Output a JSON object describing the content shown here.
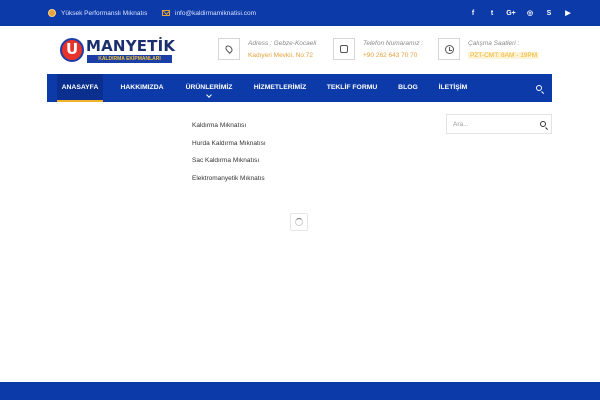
{
  "topbar": {
    "slogan": "Yüksek Performanslı Mıknatıs",
    "email": "info@kaldirmamiknatisi.com",
    "social": [
      {
        "icon": "facebook-icon",
        "glyph": "f"
      },
      {
        "icon": "twitter-icon",
        "glyph": "t"
      },
      {
        "icon": "google-plus-icon",
        "glyph": "G+"
      },
      {
        "icon": "instagram-icon",
        "glyph": "◎"
      },
      {
        "icon": "skype-icon",
        "glyph": "S"
      },
      {
        "icon": "youtube-icon",
        "glyph": "▶"
      }
    ]
  },
  "logo": {
    "title": "MANYETİK",
    "subtitle": "KALDIRMA EKİPMANLARI"
  },
  "contact": {
    "address_label": "Adress : Gebze-Kocaeli",
    "address_value": "Kadıyeri Mevkii, No:72",
    "phone_label": "Telefon Numaramız :",
    "phone_value": "+90 262 643 70 70",
    "hours_label": "Çalışma Saatleri :",
    "hours_value": "PZT-CMT: 8AM - 19PM"
  },
  "nav": {
    "items": [
      {
        "label": "ANASAYFA",
        "active": true
      },
      {
        "label": "HAKKIMIZDA"
      },
      {
        "label": "ÜRÜNLERİMİZ",
        "has_dropdown": true
      },
      {
        "label": "HİZMETLERİMİZ"
      },
      {
        "label": "TEKLİF FORMU"
      },
      {
        "label": "BLOG"
      },
      {
        "label": "İLETİŞİM"
      }
    ]
  },
  "dropdown": {
    "items": [
      "Kaldırma Mıknatısı",
      "Hurda Kaldırma Mıknatısı",
      "Sac Kaldırma Mıknatısı",
      "Elektromanyetik Mıknatıs"
    ]
  },
  "sidebar": {
    "search_placeholder": "Ara..."
  },
  "colors": {
    "brand_blue": "#0d3aa9",
    "accent_gold": "#f0b12b",
    "logo_red": "#e8322c"
  }
}
